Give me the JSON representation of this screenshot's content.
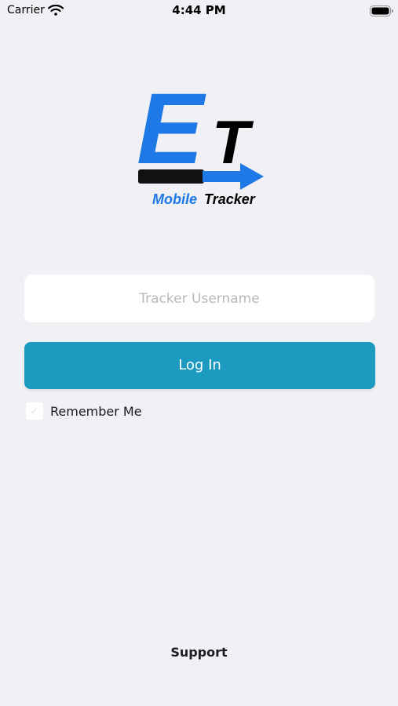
{
  "status_bar": {
    "carrier": "Carrier",
    "time": "4:44 PM",
    "icons": [
      "wifi-icon",
      "battery-icon"
    ]
  },
  "logo": {
    "letter_e": "E",
    "letter_t": "T",
    "word_mobile": "Mobile",
    "word_tracker": "Tracker",
    "colors": {
      "blue": "#1e78e6",
      "black": "#000000"
    }
  },
  "login_form": {
    "username": {
      "placeholder": "Tracker Username",
      "value": ""
    },
    "login_button_label": "Log In",
    "remember_me": {
      "label": "Remember Me",
      "checked": false,
      "check_glyph": "✓"
    }
  },
  "footer": {
    "support_label": "Support"
  },
  "theme": {
    "background": "#f0f0f5",
    "accent": "#1c9abf"
  }
}
